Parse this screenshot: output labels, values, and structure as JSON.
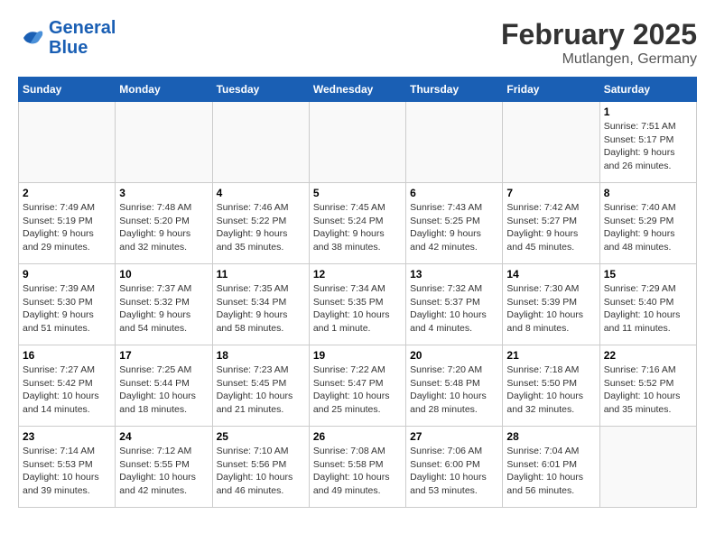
{
  "header": {
    "logo_general": "General",
    "logo_blue": "Blue",
    "month_title": "February 2025",
    "location": "Mutlangen, Germany"
  },
  "weekdays": [
    "Sunday",
    "Monday",
    "Tuesday",
    "Wednesday",
    "Thursday",
    "Friday",
    "Saturday"
  ],
  "weeks": [
    [
      {
        "day": "",
        "info": ""
      },
      {
        "day": "",
        "info": ""
      },
      {
        "day": "",
        "info": ""
      },
      {
        "day": "",
        "info": ""
      },
      {
        "day": "",
        "info": ""
      },
      {
        "day": "",
        "info": ""
      },
      {
        "day": "1",
        "info": "Sunrise: 7:51 AM\nSunset: 5:17 PM\nDaylight: 9 hours and 26 minutes."
      }
    ],
    [
      {
        "day": "2",
        "info": "Sunrise: 7:49 AM\nSunset: 5:19 PM\nDaylight: 9 hours and 29 minutes."
      },
      {
        "day": "3",
        "info": "Sunrise: 7:48 AM\nSunset: 5:20 PM\nDaylight: 9 hours and 32 minutes."
      },
      {
        "day": "4",
        "info": "Sunrise: 7:46 AM\nSunset: 5:22 PM\nDaylight: 9 hours and 35 minutes."
      },
      {
        "day": "5",
        "info": "Sunrise: 7:45 AM\nSunset: 5:24 PM\nDaylight: 9 hours and 38 minutes."
      },
      {
        "day": "6",
        "info": "Sunrise: 7:43 AM\nSunset: 5:25 PM\nDaylight: 9 hours and 42 minutes."
      },
      {
        "day": "7",
        "info": "Sunrise: 7:42 AM\nSunset: 5:27 PM\nDaylight: 9 hours and 45 minutes."
      },
      {
        "day": "8",
        "info": "Sunrise: 7:40 AM\nSunset: 5:29 PM\nDaylight: 9 hours and 48 minutes."
      }
    ],
    [
      {
        "day": "9",
        "info": "Sunrise: 7:39 AM\nSunset: 5:30 PM\nDaylight: 9 hours and 51 minutes."
      },
      {
        "day": "10",
        "info": "Sunrise: 7:37 AM\nSunset: 5:32 PM\nDaylight: 9 hours and 54 minutes."
      },
      {
        "day": "11",
        "info": "Sunrise: 7:35 AM\nSunset: 5:34 PM\nDaylight: 9 hours and 58 minutes."
      },
      {
        "day": "12",
        "info": "Sunrise: 7:34 AM\nSunset: 5:35 PM\nDaylight: 10 hours and 1 minute."
      },
      {
        "day": "13",
        "info": "Sunrise: 7:32 AM\nSunset: 5:37 PM\nDaylight: 10 hours and 4 minutes."
      },
      {
        "day": "14",
        "info": "Sunrise: 7:30 AM\nSunset: 5:39 PM\nDaylight: 10 hours and 8 minutes."
      },
      {
        "day": "15",
        "info": "Sunrise: 7:29 AM\nSunset: 5:40 PM\nDaylight: 10 hours and 11 minutes."
      }
    ],
    [
      {
        "day": "16",
        "info": "Sunrise: 7:27 AM\nSunset: 5:42 PM\nDaylight: 10 hours and 14 minutes."
      },
      {
        "day": "17",
        "info": "Sunrise: 7:25 AM\nSunset: 5:44 PM\nDaylight: 10 hours and 18 minutes."
      },
      {
        "day": "18",
        "info": "Sunrise: 7:23 AM\nSunset: 5:45 PM\nDaylight: 10 hours and 21 minutes."
      },
      {
        "day": "19",
        "info": "Sunrise: 7:22 AM\nSunset: 5:47 PM\nDaylight: 10 hours and 25 minutes."
      },
      {
        "day": "20",
        "info": "Sunrise: 7:20 AM\nSunset: 5:48 PM\nDaylight: 10 hours and 28 minutes."
      },
      {
        "day": "21",
        "info": "Sunrise: 7:18 AM\nSunset: 5:50 PM\nDaylight: 10 hours and 32 minutes."
      },
      {
        "day": "22",
        "info": "Sunrise: 7:16 AM\nSunset: 5:52 PM\nDaylight: 10 hours and 35 minutes."
      }
    ],
    [
      {
        "day": "23",
        "info": "Sunrise: 7:14 AM\nSunset: 5:53 PM\nDaylight: 10 hours and 39 minutes."
      },
      {
        "day": "24",
        "info": "Sunrise: 7:12 AM\nSunset: 5:55 PM\nDaylight: 10 hours and 42 minutes."
      },
      {
        "day": "25",
        "info": "Sunrise: 7:10 AM\nSunset: 5:56 PM\nDaylight: 10 hours and 46 minutes."
      },
      {
        "day": "26",
        "info": "Sunrise: 7:08 AM\nSunset: 5:58 PM\nDaylight: 10 hours and 49 minutes."
      },
      {
        "day": "27",
        "info": "Sunrise: 7:06 AM\nSunset: 6:00 PM\nDaylight: 10 hours and 53 minutes."
      },
      {
        "day": "28",
        "info": "Sunrise: 7:04 AM\nSunset: 6:01 PM\nDaylight: 10 hours and 56 minutes."
      },
      {
        "day": "",
        "info": ""
      }
    ]
  ]
}
